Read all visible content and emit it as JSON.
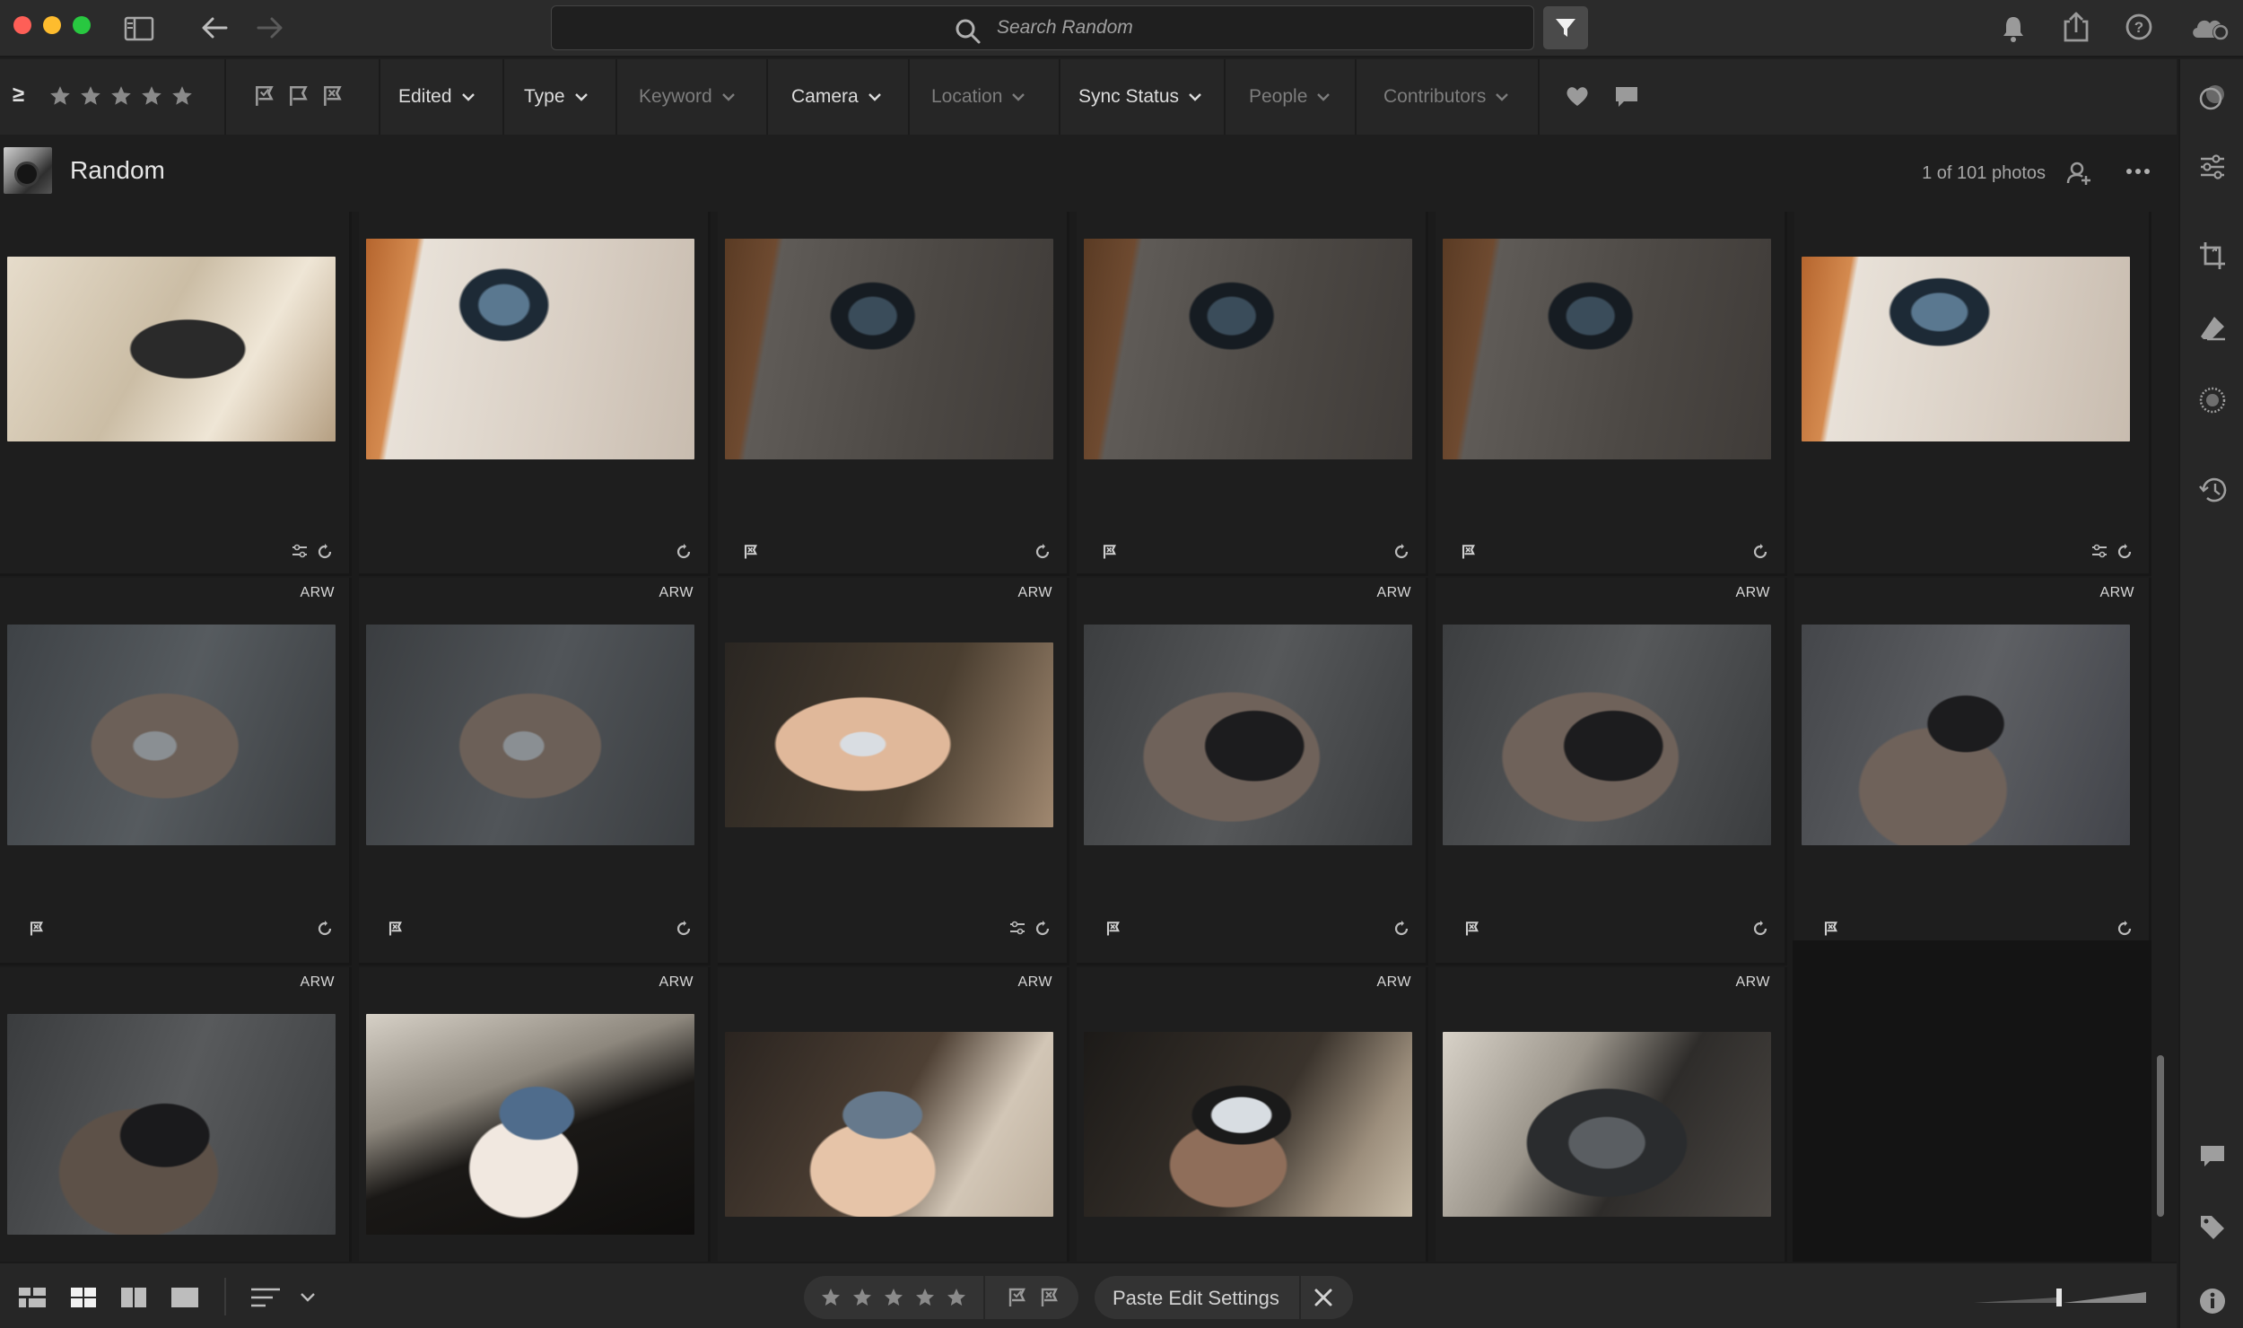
{
  "search": {
    "placeholder": "Search Random",
    "value": ""
  },
  "filter_bar": {
    "rating_operator": "≥",
    "filters": [
      {
        "label": "Edited",
        "enabled": true
      },
      {
        "label": "Type",
        "enabled": true
      },
      {
        "label": "Keyword",
        "enabled": false
      },
      {
        "label": "Camera",
        "enabled": true
      },
      {
        "label": "Location",
        "enabled": false
      },
      {
        "label": "Sync Status",
        "enabled": true
      },
      {
        "label": "People",
        "enabled": false
      },
      {
        "label": "Contributors",
        "enabled": false
      }
    ]
  },
  "album": {
    "title": "Random",
    "photo_count": "1 of 101 photos"
  },
  "grid": {
    "format_label": "ARW",
    "photos": [
      {
        "subject": "backpack on sofa",
        "format": "",
        "flag": false,
        "edited": true
      },
      {
        "subject": "laptop held up",
        "format": "",
        "flag": false,
        "edited": false
      },
      {
        "subject": "laptop held up (dark)",
        "format": "",
        "flag": true,
        "edited": false
      },
      {
        "subject": "laptop held up (dark)",
        "format": "",
        "flag": true,
        "edited": false
      },
      {
        "subject": "laptop held up (dark)",
        "format": "",
        "flag": true,
        "edited": false
      },
      {
        "subject": "laptop held up",
        "format": "",
        "flag": false,
        "edited": true
      },
      {
        "subject": "memory cards in palm",
        "format": "ARW",
        "flag": true,
        "edited": false
      },
      {
        "subject": "memory cards in palm",
        "format": "ARW",
        "flag": true,
        "edited": false
      },
      {
        "subject": "memory cards in palm",
        "format": "ARW",
        "flag": false,
        "edited": true
      },
      {
        "subject": "portable ssd in hand",
        "format": "ARW",
        "flag": true,
        "edited": false
      },
      {
        "subject": "portable ssd in hand",
        "format": "ARW",
        "flag": true,
        "edited": false
      },
      {
        "subject": "portable ssd in hand",
        "format": "ARW",
        "flag": true,
        "edited": false
      },
      {
        "subject": "portable ssd in hand",
        "format": "ARW",
        "flag": false,
        "edited": false
      },
      {
        "subject": "blue ssd in hand",
        "format": "ARW",
        "flag": false,
        "edited": false
      },
      {
        "subject": "blue ssd in hand",
        "format": "ARW",
        "flag": false,
        "edited": false
      },
      {
        "subject": "phone in hand",
        "format": "ARW",
        "flag": false,
        "edited": false
      },
      {
        "subject": "camera card slot",
        "format": "ARW",
        "flag": false,
        "edited": false
      }
    ]
  },
  "bottom_bar": {
    "paste_label": "Paste Edit Settings"
  },
  "icons": [
    "sidebar-toggle-icon",
    "back-arrow-icon",
    "forward-arrow-icon",
    "search-icon",
    "filter-icon",
    "bell-icon",
    "share-icon",
    "help-icon",
    "cloud-icon",
    "star-icon",
    "flag-icon",
    "heart-icon",
    "comment-icon",
    "add-person-icon",
    "more-icon",
    "sync-icon",
    "edited-icon",
    "presets-icon",
    "sliders-icon",
    "crop-icon",
    "eraser-icon",
    "masking-icon",
    "history-icon",
    "tag-icon",
    "info-icon"
  ],
  "colors": {
    "accent_bg": "#1e1e1e",
    "toolbar_bg": "#2b2b2b",
    "filter_button": "#4a4a4a"
  }
}
